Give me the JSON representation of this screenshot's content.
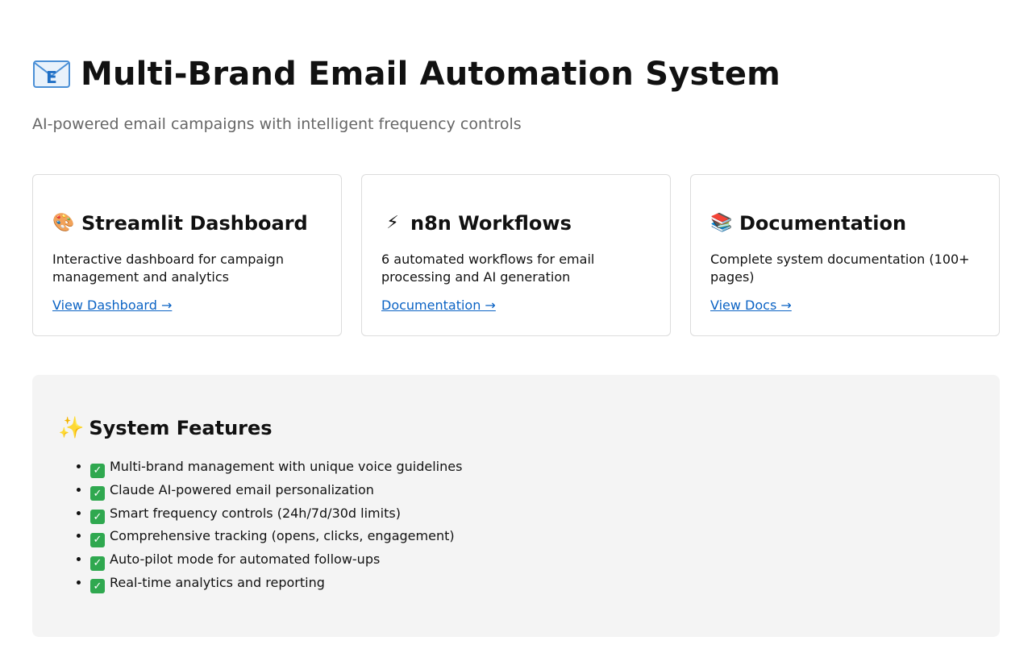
{
  "header": {
    "title": "Multi-Brand Email Automation System",
    "title_icon": "email-envelope-icon",
    "subtitle": "AI-powered email campaigns with intelligent frequency controls"
  },
  "cards": [
    {
      "icon": "palette-icon",
      "icon_glyph": "🎨",
      "title": "Streamlit Dashboard",
      "description": "Interactive dashboard for campaign management and analytics",
      "link_label": "View Dashboard →"
    },
    {
      "icon": "lightning-icon",
      "icon_glyph": "⚡",
      "title": "n8n Workflows",
      "description": "6 automated workflows for email processing and AI generation",
      "link_label": "Documentation →"
    },
    {
      "icon": "books-icon",
      "icon_glyph": "📚",
      "title": "Documentation",
      "description": "Complete system documentation (100+ pages)",
      "link_label": "View Docs →"
    }
  ],
  "features": {
    "icon": "sparkles-icon",
    "title": "System Features",
    "items": [
      "Multi-brand management with unique voice guidelines",
      "Claude AI-powered email personalization",
      "Smart frequency controls (24h/7d/30d limits)",
      "Comprehensive tracking (opens, clicks, engagement)",
      "Auto-pilot mode for automated follow-ups",
      "Real-time analytics and reporting"
    ]
  },
  "colors": {
    "link": "#0b63c4",
    "subtitle": "#666666",
    "features_bg": "#f4f4f4",
    "check_green": "#2fa84f"
  }
}
